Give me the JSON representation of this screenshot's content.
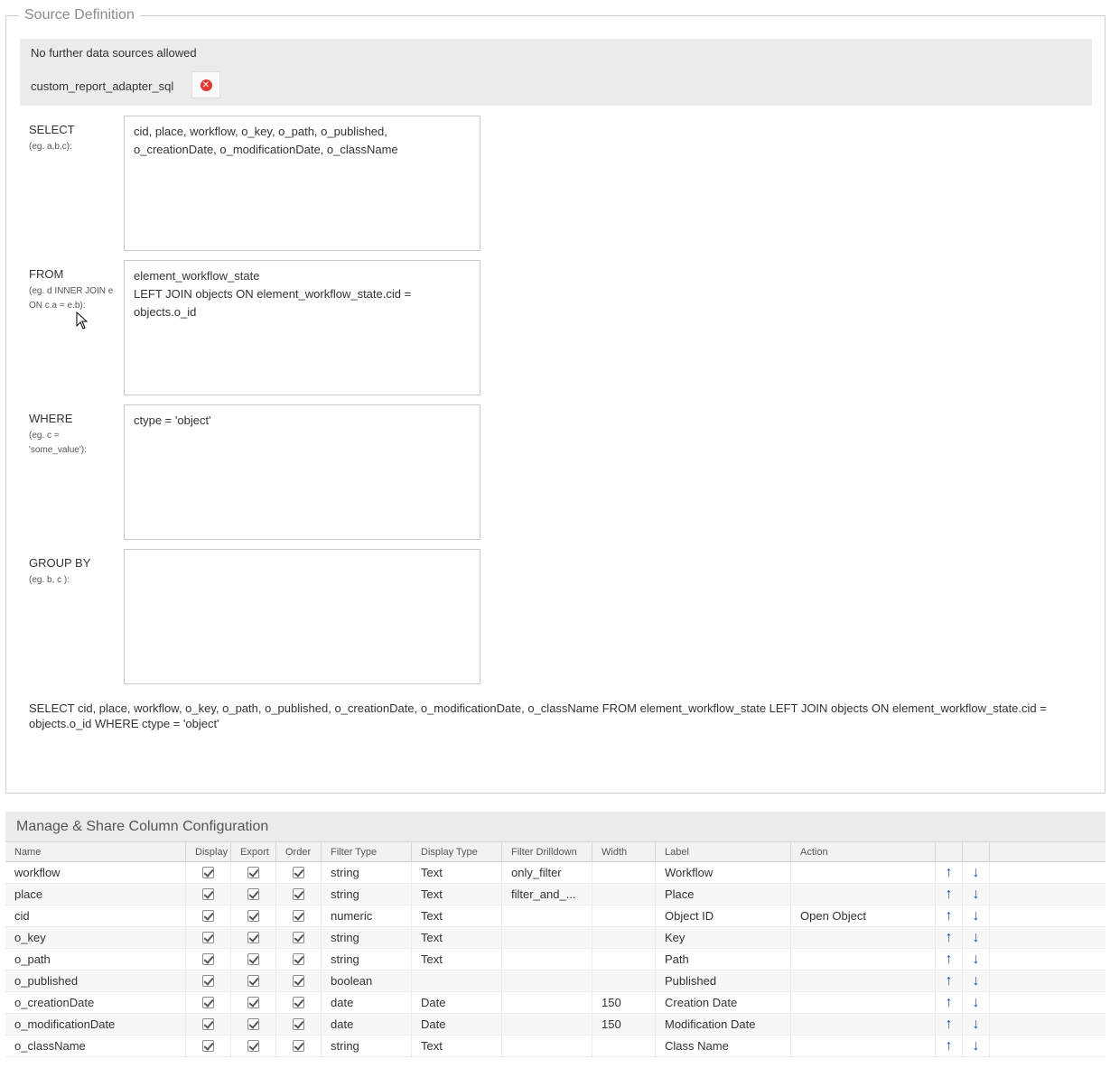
{
  "source_definition": {
    "legend": "Source Definition",
    "no_more_sources": "No further data sources allowed",
    "adapter": "custom_report_adapter_sql",
    "select": {
      "label": "SELECT",
      "hint": "(eg. a,b,c):",
      "value": "cid, place, workflow, o_key, o_path, o_published,\no_creationDate, o_modificationDate, o_className"
    },
    "from": {
      "label": "FROM",
      "hint": "(eg. d INNER JOIN e ON c.a = e.b):",
      "value": "element_workflow_state\nLEFT JOIN objects ON element_workflow_state.cid =\nobjects.o_id"
    },
    "where": {
      "label": "WHERE",
      "hint": "(eg. c = 'some_value'):",
      "value": "ctype = 'object'"
    },
    "group_by": {
      "label": "GROUP BY",
      "hint": "(eg. b, c ):",
      "value": ""
    },
    "sql_preview": "SELECT cid, place, workflow, o_key, o_path, o_published, o_creationDate, o_modificationDate, o_className FROM element_workflow_state LEFT JOIN objects ON element_workflow_state.cid = objects.o_id WHERE ctype = 'object'"
  },
  "column_config": {
    "title": "Manage & Share Column Configuration",
    "headers": [
      "Name",
      "Display",
      "Export",
      "Order",
      "Filter Type",
      "Display Type",
      "Filter Drilldown",
      "Width",
      "Label",
      "Action"
    ],
    "rows": [
      {
        "name": "workflow",
        "filter_type": "string",
        "display_type": "Text",
        "filter_drilldown": "only_filter",
        "width": "",
        "label": "Workflow",
        "action": ""
      },
      {
        "name": "place",
        "filter_type": "string",
        "display_type": "Text",
        "filter_drilldown": "filter_and_...",
        "width": "",
        "label": "Place",
        "action": ""
      },
      {
        "name": "cid",
        "filter_type": "numeric",
        "display_type": "Text",
        "filter_drilldown": "",
        "width": "",
        "label": "Object ID",
        "action": "Open Object"
      },
      {
        "name": "o_key",
        "filter_type": "string",
        "display_type": "Text",
        "filter_drilldown": "",
        "width": "",
        "label": "Key",
        "action": ""
      },
      {
        "name": "o_path",
        "filter_type": "string",
        "display_type": "Text",
        "filter_drilldown": "",
        "width": "",
        "label": "Path",
        "action": ""
      },
      {
        "name": "o_published",
        "filter_type": "boolean",
        "display_type": "",
        "filter_drilldown": "",
        "width": "",
        "label": "Published",
        "action": ""
      },
      {
        "name": "o_creationDate",
        "filter_type": "date",
        "display_type": "Date",
        "filter_drilldown": "",
        "width": "150",
        "label": "Creation Date",
        "action": ""
      },
      {
        "name": "o_modificationDate",
        "filter_type": "date",
        "display_type": "Date",
        "filter_drilldown": "",
        "width": "150",
        "label": "Modification Date",
        "action": ""
      },
      {
        "name": "o_className",
        "filter_type": "string",
        "display_type": "Text",
        "filter_drilldown": "",
        "width": "",
        "label": "Class Name",
        "action": ""
      }
    ]
  },
  "icons": {
    "remove": "remove-circle-icon",
    "move_up": "arrow-up-icon",
    "move_down": "arrow-down-icon",
    "checked": "checkbox-checked-icon"
  },
  "colors": {
    "remove_icon": "#e03b32",
    "arrows": "#1e4fa8",
    "panel_bg": "#ebebeb"
  }
}
